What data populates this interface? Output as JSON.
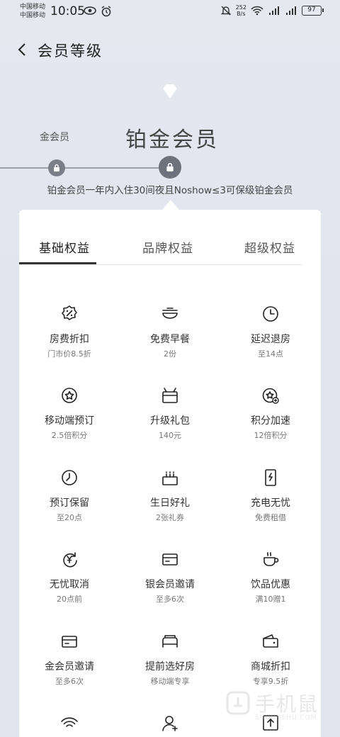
{
  "status_bar": {
    "carrier1": "中国移动",
    "carrier2": "中国移动",
    "time": "10:05",
    "speed_value": "252",
    "speed_unit": "B/s",
    "battery": "97"
  },
  "header": {
    "title": "会员等级"
  },
  "level": {
    "current": "金会员",
    "target": "铂金会员",
    "note": "铂金会员一年内入住30间夜且Noshow≤3可保级铂金会员"
  },
  "tabs": [
    {
      "label": "基础权益"
    },
    {
      "label": "品牌权益"
    },
    {
      "label": "超级权益"
    }
  ],
  "benefits": [
    {
      "title": "房费折扣",
      "sub": "门市价8.5折",
      "icon": "discount-badge-icon"
    },
    {
      "title": "免费早餐",
      "sub": "2份",
      "icon": "bowl-icon"
    },
    {
      "title": "延迟退房",
      "sub": "至14点",
      "icon": "clock-icon"
    },
    {
      "title": "移动端预订",
      "sub": "2.5倍积分",
      "icon": "star-badge-icon"
    },
    {
      "title": "升级礼包",
      "sub": "140元",
      "icon": "gift-box-icon"
    },
    {
      "title": "积分加速",
      "sub": "12倍积分",
      "icon": "star-plus-icon"
    },
    {
      "title": "预订保留",
      "sub": "至20点",
      "icon": "clock-hand-icon"
    },
    {
      "title": "生日好礼",
      "sub": "2张礼券",
      "icon": "cake-icon"
    },
    {
      "title": "充电无忧",
      "sub": "免费租借",
      "icon": "power-bank-icon"
    },
    {
      "title": "无忧取消",
      "sub": "20点前",
      "icon": "yen-refresh-icon"
    },
    {
      "title": "银会员邀请",
      "sub": "至多6次",
      "icon": "card-icon"
    },
    {
      "title": "饮品优惠",
      "sub": "满10赠1",
      "icon": "coffee-cup-icon"
    },
    {
      "title": "金会员邀请",
      "sub": "至多6次",
      "icon": "card-icon"
    },
    {
      "title": "提前选好房",
      "sub": "移动端专享",
      "icon": "bed-icon"
    },
    {
      "title": "商城折扣",
      "sub": "专享9.5折",
      "icon": "wallet-icon"
    },
    {
      "title": "",
      "sub": "",
      "icon": "wifi-icon"
    },
    {
      "title": "",
      "sub": "",
      "icon": "user-plus-icon"
    },
    {
      "title": "",
      "sub": "",
      "icon": "upload-box-icon"
    }
  ],
  "watermark": {
    "text": "手机鼠",
    "url": "SHOUJISHU.COM"
  }
}
